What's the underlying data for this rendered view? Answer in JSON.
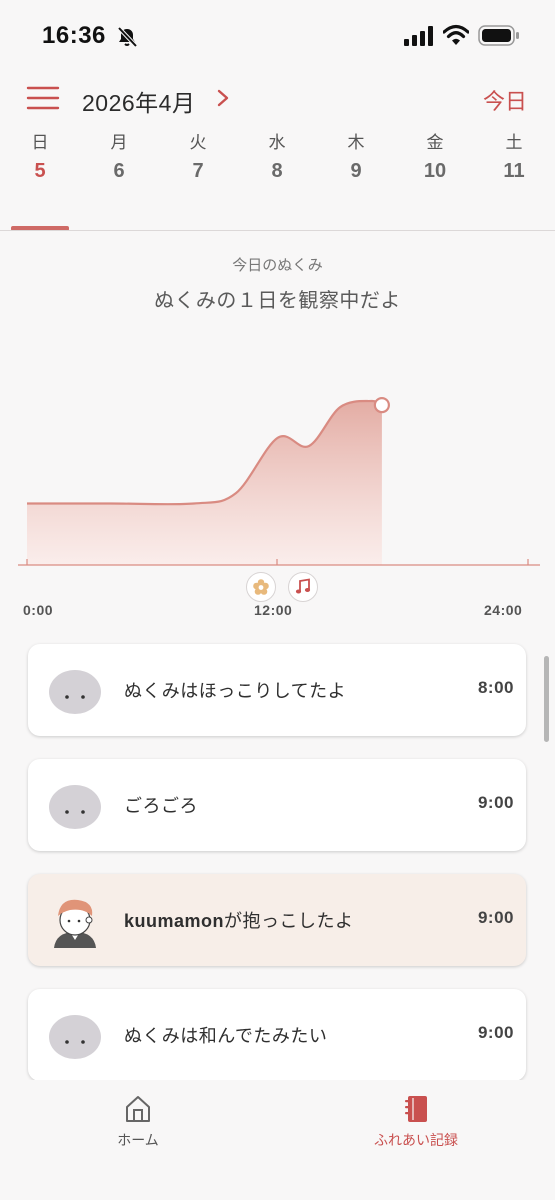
{
  "status_bar": {
    "time": "16:36",
    "icons": [
      "bell-muted-icon",
      "signal-icon",
      "wifi-icon",
      "battery-icon"
    ]
  },
  "header": {
    "menu_icon": "hamburger-icon",
    "month": "2026年4月",
    "next_icon": "chevron-right-icon",
    "today_label": "今日"
  },
  "week": {
    "days": [
      {
        "name": "日",
        "num": "5",
        "active": true
      },
      {
        "name": "月",
        "num": "6",
        "active": false
      },
      {
        "name": "火",
        "num": "7",
        "active": false
      },
      {
        "name": "水",
        "num": "8",
        "active": false
      },
      {
        "name": "木",
        "num": "9",
        "active": false
      },
      {
        "name": "金",
        "num": "10",
        "active": false
      },
      {
        "name": "土",
        "num": "11",
        "active": false
      }
    ]
  },
  "chart": {
    "subtitle": "今日のぬくみ",
    "title": "ぬくみの１日を観察中だよ",
    "markers": [
      "flower-icon",
      "music-note-icon"
    ]
  },
  "chart_data": {
    "type": "area",
    "x": [
      "0:00",
      "4:00",
      "8:00",
      "10:00",
      "12:00",
      "13:30",
      "15:00",
      "16:30",
      "17:00"
    ],
    "y": [
      30,
      30,
      30,
      35,
      62,
      58,
      77,
      80,
      78
    ],
    "x_ticks": [
      "0:00",
      "12:00",
      "24:00"
    ],
    "x_range": [
      "0:00",
      "24:00"
    ],
    "ylim": [
      0,
      100
    ],
    "color": "#d98b82",
    "current_point": "17:00"
  },
  "log": [
    {
      "avatar": "fluffy-creature-icon",
      "prefix": "",
      "text": "ぬくみはほっこりしてたよ",
      "time": "8:00",
      "highlight": false
    },
    {
      "avatar": "fluffy-creature-icon",
      "prefix": "",
      "text": "ごろごろ",
      "time": "9:00",
      "highlight": false
    },
    {
      "avatar": "user-avatar-icon",
      "prefix": "kuumamon",
      "text": "が抱っこしたよ",
      "time": "9:00",
      "highlight": true
    },
    {
      "avatar": "fluffy-creature-icon",
      "prefix": "",
      "text": "ぬくみは和んでたみたい",
      "time": "9:00",
      "highlight": false
    }
  ],
  "nav": {
    "home_label": "ホーム",
    "log_label": "ふれあい記録"
  },
  "colors": {
    "accent": "#c9504f",
    "chart_fill": "#e7b5ad",
    "highlight_card": "#f7eee8"
  }
}
